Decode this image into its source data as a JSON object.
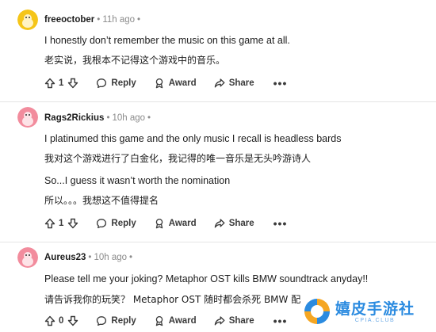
{
  "comments": [
    {
      "author": "freeoctober",
      "time": "11h ago",
      "lines": [
        "I honestly don’t remember the music on this game at all.",
        "老实说，我根本不记得这个游戏中的音乐。"
      ],
      "votes": "1",
      "avatar_color": "#f5c518"
    },
    {
      "author": "Rags2Rickius",
      "time": "10h ago",
      "lines": [
        "I platinumed this game and the only music I recall is headless bards",
        "我对这个游戏进行了白金化，我记得的唯一音乐是无头吟游诗人",
        "So...I guess it wasn’t worth the nomination",
        "所以。。。我想这不值得提名"
      ],
      "votes": "1",
      "avatar_color": "#f28c9d"
    },
    {
      "author": "Aureus23",
      "time": "10h ago",
      "lines": [
        "Please tell me your joking? Metaphor OST kills BMW soundtrack anyday!!",
        "请告诉我你的玩笑？ Metaphor OST 随时都会杀死 BMW 配"
      ],
      "votes": "0",
      "avatar_color": "#f28c9d"
    }
  ],
  "actions": {
    "reply": "Reply",
    "award": "Award",
    "share": "Share",
    "more": "•••"
  },
  "icons": {
    "upvote": "upvote-icon",
    "downvote": "downvote-icon",
    "reply": "reply-icon",
    "award": "award-icon",
    "share": "share-icon"
  },
  "watermark": {
    "title": "嬉皮手游社",
    "subtitle": "CPIA.CLUB"
  },
  "colors": {
    "meta_gray": "#8b8b8b",
    "divider": "#e5e5e5",
    "watermark_blue": "#2b8be0"
  }
}
